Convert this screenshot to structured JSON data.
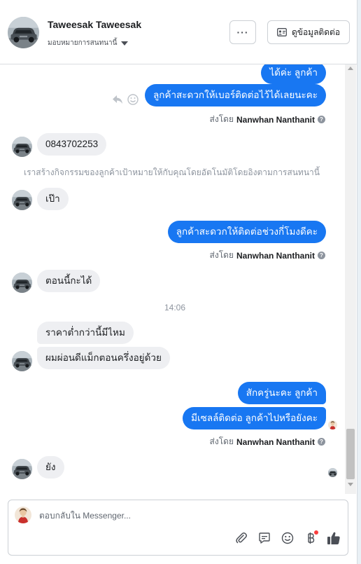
{
  "header": {
    "name": "Taweesak Taweesak",
    "assign_label": "มอบหมายการสนทนานี้",
    "more_label": "···",
    "contact_label": "ดูข้อมูลติดต่อ"
  },
  "messages": {
    "out1": "ได้ค่ะ ลูกค้า",
    "out2": "ลูกค้าสะดวกให้เบอร์ติดต่อไว้ได้เลยนะคะ",
    "sent_prefix": "ส่งโดย",
    "agent_name": "Nanwhan Nanthanit",
    "in_phone": "0843702253",
    "system_note": "เราสร้างกิจกรรมของลูกค้าเป้าหมายให้กับคุณโดยอัตโนมัติโดยอิงตามการสนทนานี้",
    "in_pao": "เป๊า",
    "out3": "ลูกค้าสะดวกให้ติดต่อช่วงกี่โมงดีคะ",
    "in_now": "ตอนนี้กะได้",
    "timestamp": "14:06",
    "in_price": "ราคาต่ำกว่านี้มีไหม",
    "in_gave": "ผมผ่อนดีแม็กตอนครึ่งอยู่ด้วย",
    "out4": "สักครู่นะคะ ลูกค้า",
    "out5": "มีเซลล์ติดต่อ ลูกค้าไปหรือยังคะ",
    "in_yang": "ยัง"
  },
  "composer": {
    "placeholder": "ตอบกลับใน Messenger..."
  },
  "icons": {
    "help": "?"
  },
  "colors": {
    "accent": "#1877f2",
    "incoming_bubble": "#eeeff2",
    "notification": "#fa3e3e"
  }
}
